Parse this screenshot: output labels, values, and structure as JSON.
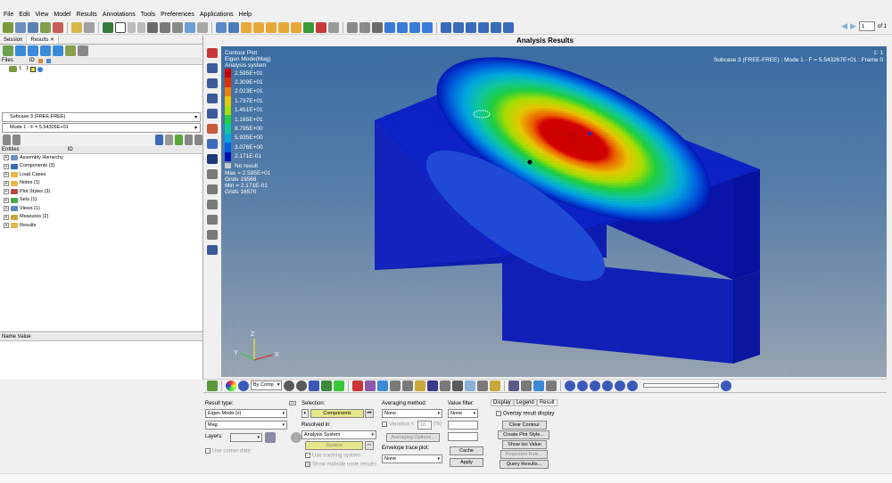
{
  "menu": [
    "File",
    "Edit",
    "View",
    "Model",
    "Results",
    "Annotations",
    "Tools",
    "Preferences",
    "Applications",
    "Help"
  ],
  "nav": {
    "page": "1",
    "of": "of 1"
  },
  "panel": {
    "tabs": [
      "Session",
      "Results"
    ],
    "files_header": "Files",
    "file_row": "1",
    "subcase_dropdown": "Subcase 3 (FREE-FREE)",
    "mode_dropdown": "Mode 1 - F = 5.54326E+01",
    "entities_header": "Entities",
    "tree": [
      "Assembly Hierarchy",
      "Components (3)",
      "Load Cases",
      "Notes (1)",
      "Plot Styles (3)",
      "Sets (1)",
      "Views (1)",
      "Measures (2)",
      "Results"
    ],
    "name_value_header": "Name Value"
  },
  "viewport": {
    "title": "Analysis Results",
    "legend_header": [
      "Contour Plot",
      "Eigen Mode(Mag)",
      "Analysis system"
    ],
    "legend_values": [
      "2.595E+01",
      "2.309E+01",
      "2.023E+01",
      "1.737E+01",
      "1.451E+01",
      "1.165E+01",
      "8.795E+00",
      "5.935E+00",
      "3.076E+00",
      "2.171E-01"
    ],
    "legend_colors": [
      "#c80000",
      "#e03000",
      "#f08000",
      "#e8c800",
      "#a8e000",
      "#20d040",
      "#10c8a0",
      "#00a8e0",
      "#0060e0",
      "#0010b0"
    ],
    "no_result": "No result",
    "stats": [
      "Max = 2.595E+01",
      "Grids 19568",
      "Min = 2.171E-01",
      "Grids 16570"
    ],
    "subcase_line1": "1: 1",
    "subcase_line2": "Subcase 3 (FREE-FREE) : Mode 1 - F = 5.543267E+01 : Frame 0",
    "triad": {
      "y": "Y",
      "z": "Z",
      "x": "X"
    }
  },
  "bottom_toolbar": {
    "by_comp": "By Comp"
  },
  "results_panel": {
    "result_type_label": "Result type:",
    "result_type_value": "Eigen Mode (v)",
    "component_value": "Mag",
    "layers_label": "Layers:",
    "use_corner": "Use corner data",
    "selection_label": "Selection:",
    "components_btn": "Components",
    "resolved_label": "Resolved in:",
    "resolved_value": "Analysis System",
    "system_btn": "System",
    "use_tracking": "Use tracking system",
    "show_midside": "Show midside node results",
    "averaging_label": "Averaging method:",
    "averaging_value": "None",
    "variation_label": "Variation <",
    "variation_value": "10",
    "variation_unit": "(%)",
    "averaging_options": "Averaging Options...",
    "envelope_label": "Envelope trace plot:",
    "envelope_value": "None",
    "value_filter_label": "Value filter:",
    "value_filter_value": "None",
    "cache_btn": "Cache",
    "apply_btn": "Apply",
    "right_tabs": [
      "Display",
      "Legend",
      "Result"
    ],
    "overlay": "Overlay result display",
    "clear_contour": "Clear Contour",
    "create_plot_style": "Create Plot Style...",
    "show_iso": "Show Iso Value",
    "projection_rule": "Projection Rule...",
    "query_results": "Query Results..."
  }
}
